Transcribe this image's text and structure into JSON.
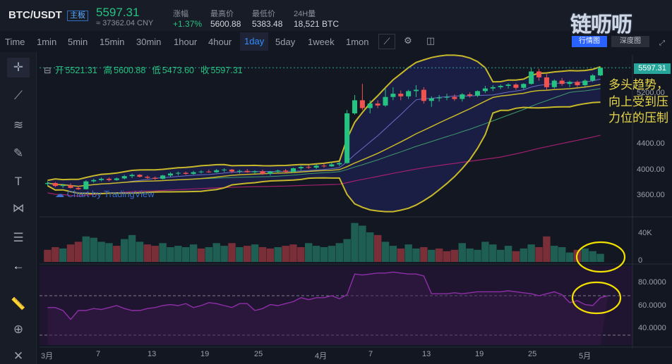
{
  "header": {
    "pair": "BTC/USDT",
    "pair_badge": "主板",
    "last_price": "5597.31",
    "cny_price": "≈ 37362.04 CNY",
    "stats": [
      {
        "label": "涨幅",
        "value": "+1.37%",
        "color": "#26c281"
      },
      {
        "label": "最高价",
        "value": "5600.88",
        "color": "#d1d4dc"
      },
      {
        "label": "最低价",
        "value": "5383.48",
        "color": "#d1d4dc"
      },
      {
        "label": "24H量",
        "value": "18,521 BTC",
        "color": "#d1d4dc"
      }
    ],
    "logo_text": "链呖呖",
    "logo_button_1": "行情图",
    "logo_button_2": "深度图"
  },
  "intervals": [
    "Time",
    "1min",
    "5min",
    "15min",
    "30min",
    "1hour",
    "4hour",
    "1day",
    "5day",
    "1week",
    "1mon"
  ],
  "active_interval": "1day",
  "toolbar_icons": [
    "indicator-icon",
    "settings-icon",
    "screenshot-icon"
  ],
  "left_tools": [
    "crosshair-icon",
    "trendline-icon",
    "fib-icon",
    "brush-icon",
    "text-icon",
    "pattern-icon",
    "measure-lines-icon",
    "back-arrow-icon",
    "ruler-icon",
    "zoom-icon",
    "close-icon"
  ],
  "ohlc": {
    "open_label": "开",
    "open": "5521.31",
    "high_label": "高",
    "high": "5600.88",
    "low_label": "低",
    "low": "5473.60",
    "close_label": "收",
    "close": "5597.31"
  },
  "watermark": "Chart by TradingView",
  "annotation": "多头趋势，向上受到压力位的压制",
  "colors": {
    "up": "#26c281",
    "down": "#ef5350",
    "annotation": "#e9d84a",
    "accent": "#2f8fff"
  },
  "chart_data": {
    "type": "candlestick",
    "price_axis_ticks": [
      "5597.31",
      "5200.00",
      "4400.00",
      "4000.00",
      "3600.00"
    ],
    "volume_axis_ticks": [
      "40K",
      "0"
    ],
    "rsi_axis_ticks": [
      "80.0000",
      "60.0000",
      "40.0000"
    ],
    "time_ticks": [
      "3月",
      "7",
      "13",
      "19",
      "25",
      "4月",
      "7",
      "13",
      "19",
      "25",
      "5月"
    ],
    "ylim": [
      3350,
      5750
    ],
    "candles": [
      [
        3820,
        3860,
        3790,
        3835
      ],
      [
        3835,
        3850,
        3770,
        3790
      ],
      [
        3790,
        3820,
        3760,
        3800
      ],
      [
        3800,
        3830,
        3750,
        3760
      ],
      [
        3760,
        3790,
        3730,
        3740
      ],
      [
        3740,
        3880,
        3735,
        3860
      ],
      [
        3860,
        3900,
        3840,
        3880
      ],
      [
        3880,
        3920,
        3860,
        3900
      ],
      [
        3900,
        3920,
        3860,
        3880
      ],
      [
        3880,
        3920,
        3870,
        3905
      ],
      [
        3905,
        3960,
        3890,
        3940
      ],
      [
        3940,
        3980,
        3910,
        3960
      ],
      [
        3960,
        3970,
        3920,
        3930
      ],
      [
        3930,
        3950,
        3900,
        3915
      ],
      [
        3915,
        3935,
        3880,
        3900
      ],
      [
        3900,
        3960,
        3890,
        3950
      ],
      [
        3950,
        4000,
        3930,
        3980
      ],
      [
        3980,
        4010,
        3950,
        3990
      ],
      [
        3990,
        4010,
        3960,
        3975
      ],
      [
        3975,
        4020,
        3960,
        4000
      ],
      [
        4000,
        4030,
        3980,
        4010
      ],
      [
        4010,
        4040,
        3990,
        4000
      ],
      [
        4000,
        4050,
        3990,
        4030
      ],
      [
        4030,
        4060,
        4000,
        4040
      ],
      [
        4040,
        4050,
        3990,
        4010
      ],
      [
        4010,
        4040,
        3980,
        4020
      ],
      [
        4020,
        4050,
        3990,
        4000
      ],
      [
        4000,
        4030,
        3980,
        4015
      ],
      [
        4015,
        4040,
        3960,
        3975
      ],
      [
        3975,
        4020,
        3950,
        4010
      ],
      [
        4010,
        4040,
        3990,
        4025
      ],
      [
        4025,
        4050,
        3990,
        4005
      ],
      [
        4005,
        4070,
        3990,
        4060
      ],
      [
        4060,
        4100,
        4030,
        4080
      ],
      [
        4080,
        4110,
        4050,
        4070
      ],
      [
        4070,
        4120,
        4050,
        4100
      ],
      [
        4100,
        4130,
        4070,
        4090
      ],
      [
        4090,
        4150,
        4080,
        4120
      ],
      [
        4120,
        4160,
        4090,
        4140
      ],
      [
        4140,
        4950,
        4130,
        4900
      ],
      [
        4900,
        5180,
        4880,
        5100
      ],
      [
        5100,
        5350,
        4950,
        4980
      ],
      [
        4980,
        5100,
        4900,
        5050
      ],
      [
        5050,
        5100,
        4980,
        5020
      ],
      [
        5020,
        5280,
        5000,
        5150
      ],
      [
        5150,
        5300,
        5100,
        5200
      ],
      [
        5200,
        5250,
        5100,
        5160
      ],
      [
        5160,
        5260,
        5120,
        5240
      ],
      [
        5240,
        5330,
        5150,
        5260
      ],
      [
        5260,
        5300,
        5050,
        5090
      ],
      [
        5090,
        5160,
        5000,
        5130
      ],
      [
        5130,
        5180,
        5080,
        5140
      ],
      [
        5140,
        5200,
        5100,
        5150
      ],
      [
        5150,
        5190,
        5090,
        5120
      ],
      [
        5120,
        5210,
        5080,
        5190
      ],
      [
        5190,
        5220,
        5140,
        5170
      ],
      [
        5170,
        5250,
        5150,
        5240
      ],
      [
        5240,
        5320,
        5210,
        5280
      ],
      [
        5280,
        5330,
        5240,
        5300
      ],
      [
        5300,
        5340,
        5270,
        5320
      ],
      [
        5320,
        5360,
        5280,
        5340
      ],
      [
        5340,
        5360,
        5260,
        5290
      ],
      [
        5290,
        5360,
        5270,
        5350
      ],
      [
        5350,
        5600,
        5340,
        5540
      ],
      [
        5540,
        5580,
        5400,
        5450
      ],
      [
        5450,
        5500,
        5250,
        5300
      ],
      [
        5300,
        5420,
        5280,
        5400
      ],
      [
        5400,
        5440,
        5320,
        5350
      ],
      [
        5350,
        5400,
        5300,
        5380
      ],
      [
        5380,
        5400,
        5300,
        5330
      ],
      [
        5330,
        5420,
        5310,
        5400
      ],
      [
        5400,
        5500,
        5380,
        5480
      ],
      [
        5480,
        5601,
        5470,
        5597
      ]
    ],
    "volume": [
      [
        18,
        0
      ],
      [
        22,
        0
      ],
      [
        20,
        1
      ],
      [
        26,
        0
      ],
      [
        30,
        0
      ],
      [
        38,
        1
      ],
      [
        36,
        1
      ],
      [
        30,
        1
      ],
      [
        28,
        1
      ],
      [
        24,
        0
      ],
      [
        34,
        1
      ],
      [
        40,
        1
      ],
      [
        30,
        1
      ],
      [
        26,
        0
      ],
      [
        24,
        0
      ],
      [
        28,
        1
      ],
      [
        22,
        1
      ],
      [
        24,
        1
      ],
      [
        22,
        1
      ],
      [
        26,
        1
      ],
      [
        20,
        0
      ],
      [
        22,
        1
      ],
      [
        28,
        1
      ],
      [
        24,
        1
      ],
      [
        28,
        0
      ],
      [
        22,
        1
      ],
      [
        24,
        0
      ],
      [
        26,
        1
      ],
      [
        22,
        0
      ],
      [
        20,
        0
      ],
      [
        22,
        1
      ],
      [
        24,
        0
      ],
      [
        26,
        0
      ],
      [
        22,
        0
      ],
      [
        28,
        1
      ],
      [
        24,
        1
      ],
      [
        22,
        1
      ],
      [
        24,
        1
      ],
      [
        28,
        1
      ],
      [
        34,
        1
      ],
      [
        58,
        1
      ],
      [
        54,
        1
      ],
      [
        44,
        1
      ],
      [
        40,
        0
      ],
      [
        30,
        1
      ],
      [
        24,
        1
      ],
      [
        20,
        0
      ],
      [
        26,
        1
      ],
      [
        20,
        1
      ],
      [
        22,
        0
      ],
      [
        18,
        1
      ],
      [
        20,
        0
      ],
      [
        16,
        0
      ],
      [
        18,
        0
      ],
      [
        28,
        1
      ],
      [
        20,
        1
      ],
      [
        18,
        1
      ],
      [
        30,
        1
      ],
      [
        26,
        1
      ],
      [
        18,
        1
      ],
      [
        24,
        1
      ],
      [
        16,
        0
      ],
      [
        20,
        1
      ],
      [
        26,
        1
      ],
      [
        22,
        0
      ],
      [
        38,
        0
      ],
      [
        24,
        1
      ],
      [
        22,
        1
      ],
      [
        14,
        1
      ],
      [
        18,
        0
      ],
      [
        20,
        1
      ],
      [
        16,
        1
      ],
      [
        12,
        1
      ]
    ],
    "rsi": [
      58,
      58,
      55,
      46,
      55,
      55,
      57,
      56,
      58,
      60,
      57,
      55,
      55,
      57,
      58,
      60,
      61,
      60,
      62,
      58,
      60,
      63,
      62,
      60,
      58,
      62,
      62,
      55,
      57,
      61,
      60,
      62,
      64,
      68,
      66,
      68,
      68,
      70,
      67,
      71,
      92,
      91,
      92,
      93,
      93,
      94,
      93,
      92,
      92,
      90,
      72,
      72,
      72,
      73,
      72,
      73,
      74,
      74,
      74,
      74,
      75,
      74,
      73,
      72,
      70,
      72,
      74,
      71,
      63,
      65,
      61,
      60,
      68,
      70
    ]
  }
}
